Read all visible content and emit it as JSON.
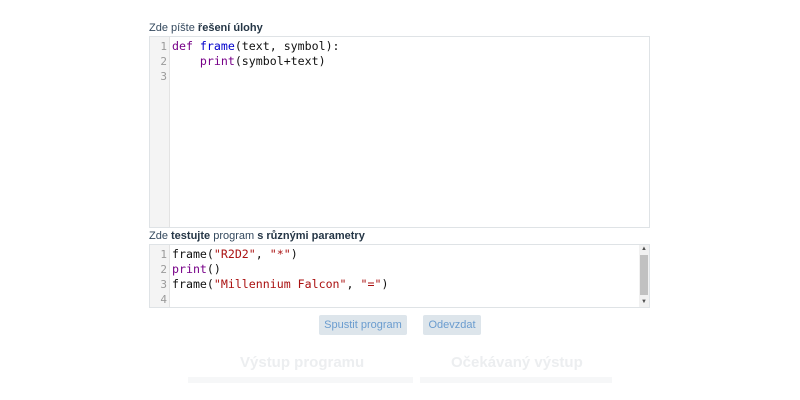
{
  "solution_label": {
    "prefix": "Zde píšte ",
    "bold": "řešení úlohy"
  },
  "solution_editor": {
    "lines": [
      {
        "n": "1",
        "tokens": [
          {
            "t": "kw",
            "v": "def "
          },
          {
            "t": "fn",
            "v": "frame"
          },
          {
            "t": "",
            "v": "(text, symbol):"
          }
        ]
      },
      {
        "n": "2",
        "tokens": [
          {
            "t": "",
            "v": "    "
          },
          {
            "t": "kw",
            "v": "print"
          },
          {
            "t": "",
            "v": "(symbol+text)"
          }
        ]
      },
      {
        "n": "3",
        "tokens": []
      }
    ]
  },
  "test_label": {
    "prefix": "Zde ",
    "bold1": "testujte",
    "middle": " program ",
    "bold2": "s různými parametry"
  },
  "test_editor": {
    "lines": [
      {
        "n": "1",
        "tokens": [
          {
            "t": "",
            "v": "frame("
          },
          {
            "t": "str",
            "v": "\"R2D2\""
          },
          {
            "t": "",
            "v": ", "
          },
          {
            "t": "str",
            "v": "\"*\""
          },
          {
            "t": "",
            "v": ")"
          }
        ]
      },
      {
        "n": "2",
        "tokens": [
          {
            "t": "kw",
            "v": "print"
          },
          {
            "t": "",
            "v": "()"
          }
        ]
      },
      {
        "n": "3",
        "tokens": [
          {
            "t": "",
            "v": "frame("
          },
          {
            "t": "str",
            "v": "\"Millennium Falcon\""
          },
          {
            "t": "",
            "v": ", "
          },
          {
            "t": "str",
            "v": "\"=\""
          },
          {
            "t": "",
            "v": ")"
          }
        ]
      },
      {
        "n": "4",
        "tokens": []
      }
    ]
  },
  "buttons": {
    "run": "Spustit program",
    "submit": "Odevzdat"
  },
  "output": {
    "program_heading": "Výstup programu",
    "expected_heading": "Očekávaný výstup"
  },
  "icons": {
    "scroll_up": "▲",
    "scroll_down": "▼"
  }
}
